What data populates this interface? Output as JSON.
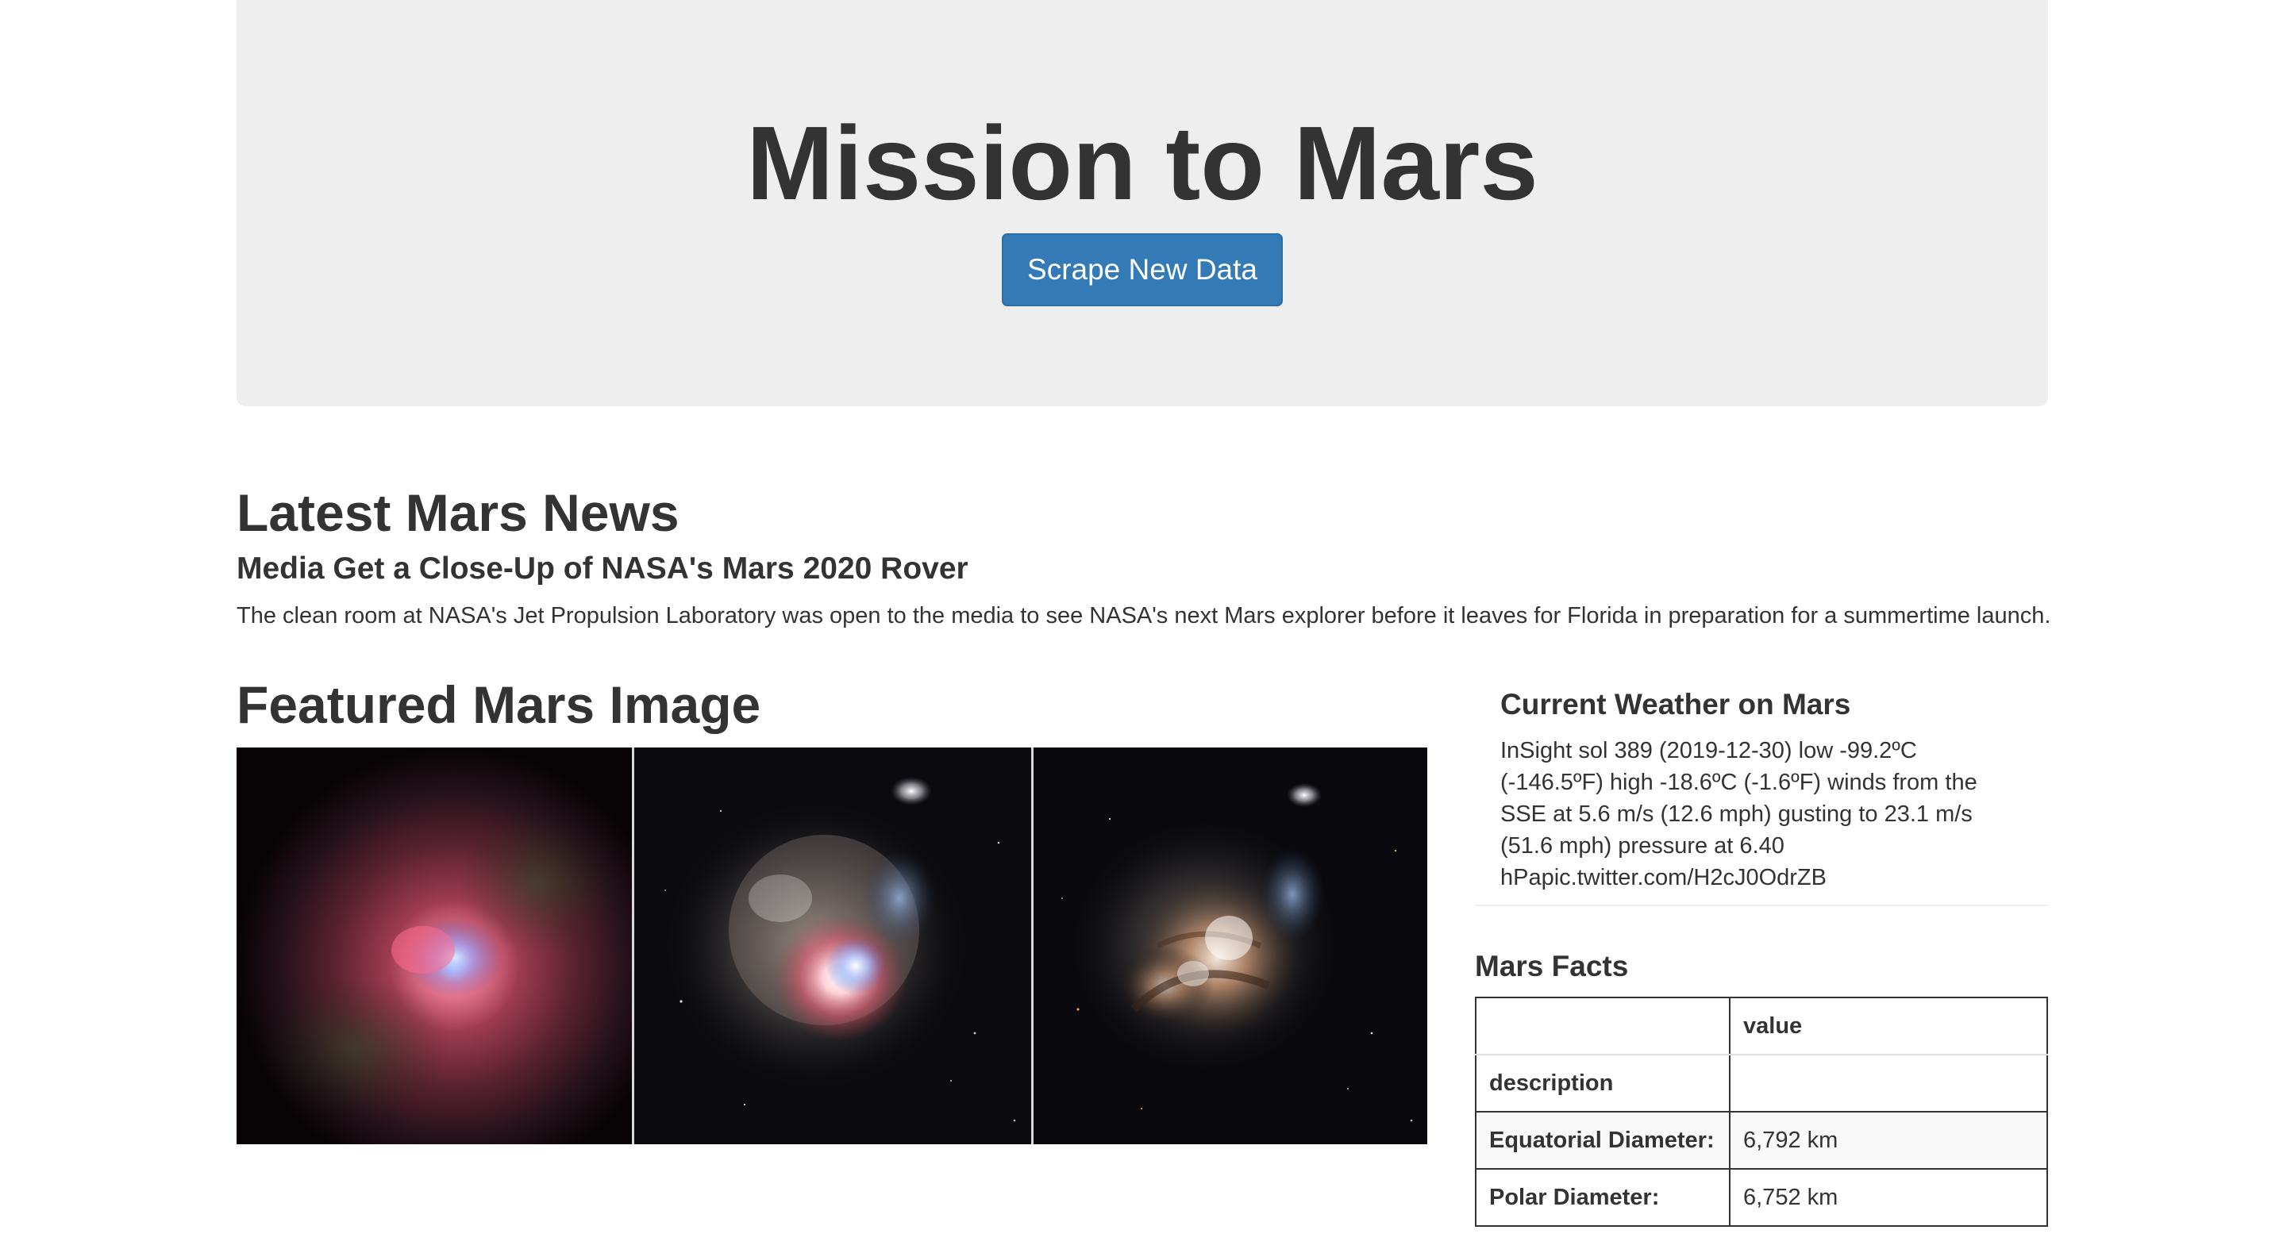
{
  "jumbotron": {
    "title": "Mission to Mars",
    "button_label": "Scrape New Data",
    "button_color": "#337ab7"
  },
  "news": {
    "heading": "Latest Mars News",
    "title": "Media Get a Close-Up of NASA's Mars 2020 Rover",
    "paragraph": "The clean room at NASA's Jet Propulsion Laboratory was open to the media to see NASA's next Mars explorer before it leaves for Florida in preparation for a summertime launch."
  },
  "featured": {
    "heading": "Featured Mars Image"
  },
  "weather": {
    "heading": "Current Weather on Mars",
    "text": "InSight sol 389 (2019-12-30) low -99.2ºC (-146.5ºF) high -18.6ºC (-1.6ºF) winds from the SSE at 5.6 m/s (12.6 mph) gusting to 23.1 m/s (51.6 mph) pressure at 6.40 hPapic.twitter.com/H2cJ0OdrZB"
  },
  "facts": {
    "heading": "Mars Facts",
    "columns": [
      "",
      "value"
    ],
    "rows": [
      {
        "label": "description",
        "value": ""
      },
      {
        "label": "Equatorial Diameter:",
        "value": "6,792 km"
      },
      {
        "label": "Polar Diameter:",
        "value": "6,752 km"
      }
    ]
  }
}
